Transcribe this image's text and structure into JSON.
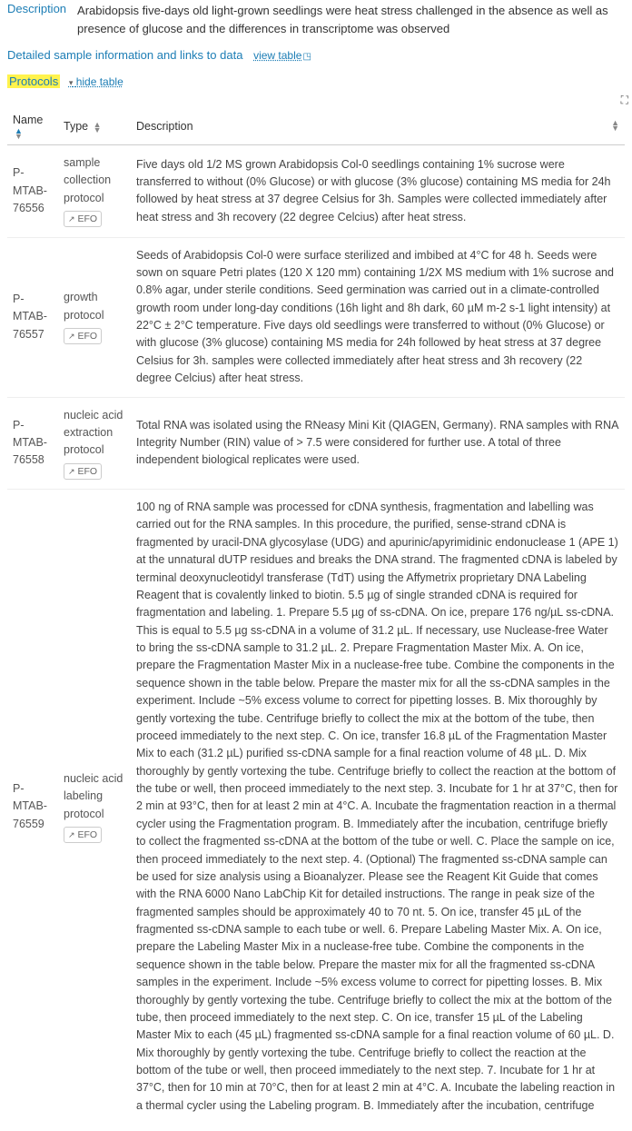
{
  "description": {
    "label": "Description",
    "text": "Arabidopsis five-days old light-grown seedlings were heat stress challenged in the absence as well as presence of glucose and the differences in transcriptome was observed"
  },
  "sampleInfo": {
    "link": "Detailed sample information and links to data",
    "viewTable": "view table"
  },
  "protocols": {
    "label": "Protocols",
    "hideTable": "hide table"
  },
  "columns": {
    "name": "Name",
    "type": "Type",
    "description": "Description"
  },
  "efoLabel": "EFO",
  "rows": [
    {
      "name": "P-MTAB-76556",
      "type": "sample collection protocol",
      "desc": "Five days old 1/2 MS grown Arabidopsis Col-0 seedlings containing 1% sucrose were transferred to without (0% Glucose) or with glucose (3% glucose) containing MS media for 24h followed by heat stress at 37 degree Celsius for 3h. Samples were collected immediately after heat stress and 3h recovery (22 degree Celcius) after heat stress."
    },
    {
      "name": "P-MTAB-76557",
      "type": "growth protocol",
      "desc": "Seeds of Arabidopsis Col-0 were surface sterilized and imbibed at 4°C for 48 h. Seeds were sown on square Petri plates (120 X 120 mm) containing 1/2X MS medium with 1% sucrose and 0.8% agar, under sterile conditions. Seed germination was carried out in a climate-controlled growth room under long-day conditions (16h light and 8h dark, 60 µM m-2 s-1 light intensity) at 22°C ± 2°C temperature. Five days old seedlings were transferred to without (0% Glucose) or with glucose (3% glucose) containing MS media for 24h followed by heat stress at 37 degree Celsius for 3h. samples were collected immediately after heat stress and 3h recovery (22 degree Celcius) after heat stress."
    },
    {
      "name": "P-MTAB-76558",
      "type": "nucleic acid extraction protocol",
      "desc": "Total RNA was isolated using the RNeasy Mini Kit (QIAGEN, Germany). RNA samples with RNA Integrity Number (RIN) value of > 7.5 were considered for further use. A total of three independent biological replicates were used."
    },
    {
      "name": "P-MTAB-76559",
      "type": "nucleic acid labeling protocol",
      "desc": "100 ng of RNA sample was processed for cDNA synthesis, fragmentation and labelling was carried out for the RNA samples. In this procedure, the purified, sense-strand cDNA is fragmented by uracil-DNA glycosylase (UDG) and apurinic/apyrimidinic endonuclease 1 (APE 1) at the unnatural dUTP residues and breaks the DNA strand. The fragmented cDNA is labeled by terminal deoxynucleotidyl transferase (TdT) using the Affymetrix proprietary DNA Labeling Reagent that is covalently linked to biotin. 5.5 µg of single stranded cDNA is required for fragmentation and labeling. 1. Prepare 5.5 µg of ss-cDNA. On ice, prepare 176 ng/µL ss-cDNA. This is equal to 5.5 µg ss-cDNA in a volume of 31.2 µL. If necessary, use Nuclease-free Water to bring the ss-cDNA sample to 31.2 µL. 2. Prepare Fragmentation Master Mix. A. On ice, prepare the Fragmentation Master Mix in a nuclease-free tube. Combine the components in the sequence shown in the table below. Prepare the master mix for all the ss-cDNA samples in the experiment. Include ~5% excess volume to correct for pipetting losses. B. Mix thoroughly by gently vortexing the tube. Centrifuge briefly to collect the mix at the bottom of the tube, then proceed immediately to the next step. C. On ice, transfer 16.8 µL of the Fragmentation Master Mix to each (31.2 µL) purified ss-cDNA sample for a final reaction volume of 48 µL. D. Mix thoroughly by gently vortexing the tube. Centrifuge briefly to collect the reaction at the bottom of the tube or well, then proceed immediately to the next step. 3. Incubate for 1 hr at 37°C, then for 2 min at 93°C, then for at least 2 min at 4°C. A. Incubate the fragmentation reaction in a thermal cycler using the Fragmentation program. B. Immediately after the incubation, centrifuge briefly to collect the fragmented ss-cDNA at the bottom of the tube or well. C. Place the sample on ice, then proceed immediately to the next step. 4. (Optional) The fragmented ss-cDNA sample can be used for size analysis using a Bioanalyzer. Please see the Reagent Kit Guide that comes with the RNA 6000 Nano LabChip Kit for detailed instructions. The range in peak size of the fragmented samples should be approximately 40 to 70 nt. 5. On ice, transfer 45 µL of the fragmented ss-cDNA sample to each tube or well. 6. Prepare Labeling Master Mix. A. On ice, prepare the Labeling Master Mix in a nuclease-free tube. Combine the components in the sequence shown in the table below. Prepare the master mix for all the fragmented ss-cDNA samples in the experiment. Include ~5% excess volume to correct for pipetting losses. B. Mix thoroughly by gently vortexing the tube. Centrifuge briefly to collect the mix at the bottom of the tube, then proceed immediately to the next step. C. On ice, transfer 15 µL of the Labeling Master Mix to each (45 µL) fragmented ss-cDNA sample for a final reaction volume of 60 µL. D. Mix thoroughly by gently vortexing the tube. Centrifuge briefly to collect the reaction at the bottom of the tube or well, then proceed immediately to the next step. 7. Incubate for 1 hr at 37°C, then for 10 min at 70°C, then for at least 2 min at 4°C. A. Incubate the labeling reaction in a thermal cycler using the Labeling program. B. Immediately after the incubation, centrifuge"
    }
  ]
}
